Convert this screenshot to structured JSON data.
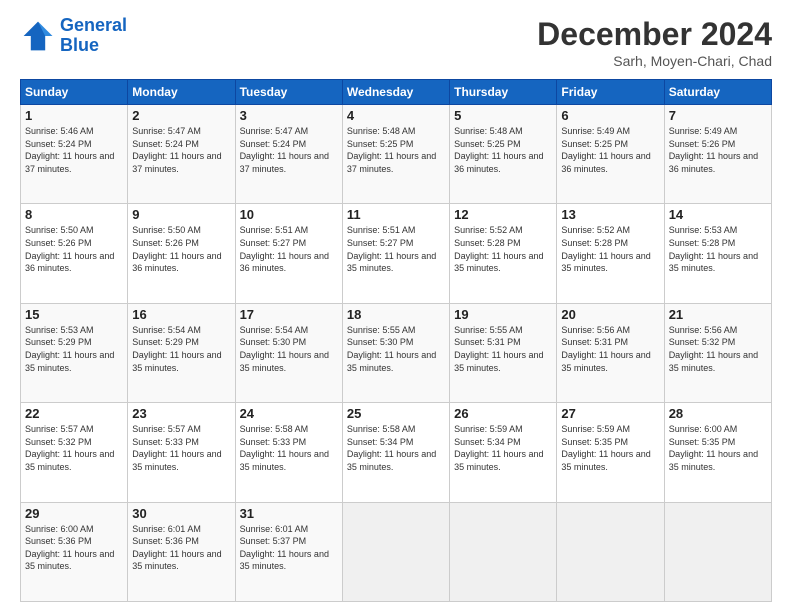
{
  "logo": {
    "line1": "General",
    "line2": "Blue"
  },
  "title": "December 2024",
  "subtitle": "Sarh, Moyen-Chari, Chad",
  "weekdays": [
    "Sunday",
    "Monday",
    "Tuesday",
    "Wednesday",
    "Thursday",
    "Friday",
    "Saturday"
  ],
  "weeks": [
    [
      {
        "day": "1",
        "sunrise": "5:46 AM",
        "sunset": "5:24 PM",
        "daylight": "11 hours and 37 minutes."
      },
      {
        "day": "2",
        "sunrise": "5:47 AM",
        "sunset": "5:24 PM",
        "daylight": "11 hours and 37 minutes."
      },
      {
        "day": "3",
        "sunrise": "5:47 AM",
        "sunset": "5:24 PM",
        "daylight": "11 hours and 37 minutes."
      },
      {
        "day": "4",
        "sunrise": "5:48 AM",
        "sunset": "5:25 PM",
        "daylight": "11 hours and 37 minutes."
      },
      {
        "day": "5",
        "sunrise": "5:48 AM",
        "sunset": "5:25 PM",
        "daylight": "11 hours and 36 minutes."
      },
      {
        "day": "6",
        "sunrise": "5:49 AM",
        "sunset": "5:25 PM",
        "daylight": "11 hours and 36 minutes."
      },
      {
        "day": "7",
        "sunrise": "5:49 AM",
        "sunset": "5:26 PM",
        "daylight": "11 hours and 36 minutes."
      }
    ],
    [
      {
        "day": "8",
        "sunrise": "5:50 AM",
        "sunset": "5:26 PM",
        "daylight": "11 hours and 36 minutes."
      },
      {
        "day": "9",
        "sunrise": "5:50 AM",
        "sunset": "5:26 PM",
        "daylight": "11 hours and 36 minutes."
      },
      {
        "day": "10",
        "sunrise": "5:51 AM",
        "sunset": "5:27 PM",
        "daylight": "11 hours and 36 minutes."
      },
      {
        "day": "11",
        "sunrise": "5:51 AM",
        "sunset": "5:27 PM",
        "daylight": "11 hours and 35 minutes."
      },
      {
        "day": "12",
        "sunrise": "5:52 AM",
        "sunset": "5:28 PM",
        "daylight": "11 hours and 35 minutes."
      },
      {
        "day": "13",
        "sunrise": "5:52 AM",
        "sunset": "5:28 PM",
        "daylight": "11 hours and 35 minutes."
      },
      {
        "day": "14",
        "sunrise": "5:53 AM",
        "sunset": "5:28 PM",
        "daylight": "11 hours and 35 minutes."
      }
    ],
    [
      {
        "day": "15",
        "sunrise": "5:53 AM",
        "sunset": "5:29 PM",
        "daylight": "11 hours and 35 minutes."
      },
      {
        "day": "16",
        "sunrise": "5:54 AM",
        "sunset": "5:29 PM",
        "daylight": "11 hours and 35 minutes."
      },
      {
        "day": "17",
        "sunrise": "5:54 AM",
        "sunset": "5:30 PM",
        "daylight": "11 hours and 35 minutes."
      },
      {
        "day": "18",
        "sunrise": "5:55 AM",
        "sunset": "5:30 PM",
        "daylight": "11 hours and 35 minutes."
      },
      {
        "day": "19",
        "sunrise": "5:55 AM",
        "sunset": "5:31 PM",
        "daylight": "11 hours and 35 minutes."
      },
      {
        "day": "20",
        "sunrise": "5:56 AM",
        "sunset": "5:31 PM",
        "daylight": "11 hours and 35 minutes."
      },
      {
        "day": "21",
        "sunrise": "5:56 AM",
        "sunset": "5:32 PM",
        "daylight": "11 hours and 35 minutes."
      }
    ],
    [
      {
        "day": "22",
        "sunrise": "5:57 AM",
        "sunset": "5:32 PM",
        "daylight": "11 hours and 35 minutes."
      },
      {
        "day": "23",
        "sunrise": "5:57 AM",
        "sunset": "5:33 PM",
        "daylight": "11 hours and 35 minutes."
      },
      {
        "day": "24",
        "sunrise": "5:58 AM",
        "sunset": "5:33 PM",
        "daylight": "11 hours and 35 minutes."
      },
      {
        "day": "25",
        "sunrise": "5:58 AM",
        "sunset": "5:34 PM",
        "daylight": "11 hours and 35 minutes."
      },
      {
        "day": "26",
        "sunrise": "5:59 AM",
        "sunset": "5:34 PM",
        "daylight": "11 hours and 35 minutes."
      },
      {
        "day": "27",
        "sunrise": "5:59 AM",
        "sunset": "5:35 PM",
        "daylight": "11 hours and 35 minutes."
      },
      {
        "day": "28",
        "sunrise": "6:00 AM",
        "sunset": "5:35 PM",
        "daylight": "11 hours and 35 minutes."
      }
    ],
    [
      {
        "day": "29",
        "sunrise": "6:00 AM",
        "sunset": "5:36 PM",
        "daylight": "11 hours and 35 minutes."
      },
      {
        "day": "30",
        "sunrise": "6:01 AM",
        "sunset": "5:36 PM",
        "daylight": "11 hours and 35 minutes."
      },
      {
        "day": "31",
        "sunrise": "6:01 AM",
        "sunset": "5:37 PM",
        "daylight": "11 hours and 35 minutes."
      },
      null,
      null,
      null,
      null
    ]
  ]
}
